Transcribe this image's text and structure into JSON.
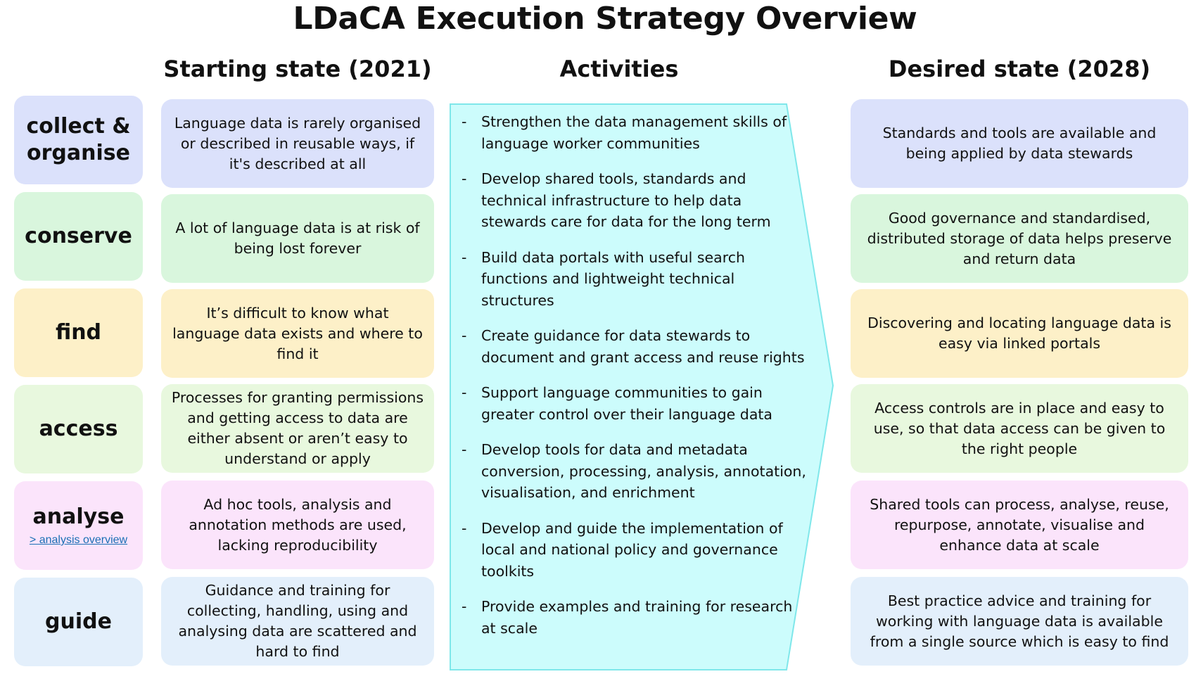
{
  "title": "LDaCA Execution Strategy Overview",
  "headers": {
    "starting": "Starting state (2021)",
    "activities": "Activities",
    "desired": "Desired state (2028)"
  },
  "colors": {
    "collect": "#dbe1fb",
    "conserve": "#d9f6dd",
    "find": "#fdf0c8",
    "access": "#e8f8de",
    "analyse": "#fbe4fb",
    "guide": "#e3effb",
    "activities_fill": "#ccfcfc",
    "activities_border": "#7fe7ea"
  },
  "rows": [
    {
      "category": "collect & organise",
      "starting": "Language data is rarely organised or described in reusable ways, if it's described at all",
      "desired": "Standards and tools are available and being applied by data stewards"
    },
    {
      "category": "conserve",
      "starting": "A lot of language data is at risk of being lost forever",
      "desired": "Good governance and standardised, distributed storage of data helps preserve and return data"
    },
    {
      "category": "find",
      "starting": "It’s difficult to know what language data exists and where to find it",
      "desired": "Discovering and locating language data is easy via linked portals"
    },
    {
      "category": "access",
      "starting": "Processes for granting permissions and getting access to data are either absent or aren’t easy to understand or apply",
      "desired": "Access controls are in place and easy to use, so that data access can be given to the right people"
    },
    {
      "category": "analyse",
      "link": "> analysis overview",
      "starting": "Ad hoc tools, analysis and annotation methods are used, lacking reproducibility",
      "desired": "Shared tools can process, analyse, reuse, repurpose, annotate, visualise and enhance data at scale"
    },
    {
      "category": "guide",
      "starting": "Guidance and training for collecting, handling, using and analysing data are scattered and hard to find",
      "desired": "Best practice advice and training for working with language data is available from a single source which is easy to find"
    }
  ],
  "activities": [
    "Strengthen the data management skills of language worker communities",
    "Develop shared tools, standards and technical infrastructure to help data stewards care for  data for the long term",
    "Build data portals with useful search functions and lightweight technical structures",
    "Create guidance for data stewards to document and grant access and reuse rights",
    "Support language communities to gain greater control over their language data",
    "Develop tools for data and metadata conversion, processing, analysis, annotation, visualisation, and enrichment",
    "Develop and guide the implementation of local and national policy and governance toolkits",
    "Provide examples and training for research at scale"
  ],
  "bullet": "-"
}
